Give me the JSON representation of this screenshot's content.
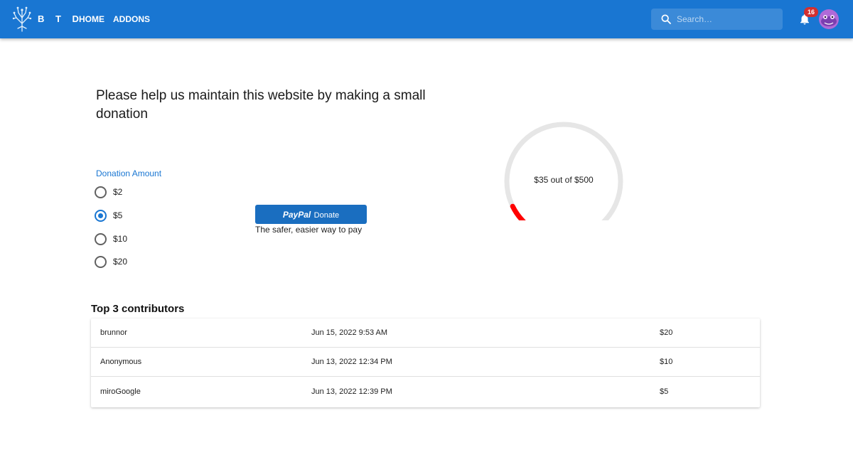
{
  "header": {
    "brand": "B T D",
    "nav": [
      "HOME",
      "ADDONS"
    ],
    "search_placeholder": "Search…",
    "notification_count": "16"
  },
  "donation": {
    "headline": "Please help us maintain this website by making a small donation",
    "amount_label": "Donation Amount",
    "options": [
      "$2",
      "$5",
      "$10",
      "$20"
    ],
    "selected": "$5",
    "paypal_brand": "PayPal",
    "paypal_label": "Donate",
    "paypal_tagline": "The safer, easier way to pay",
    "goal_text": "$35 out of $500",
    "raised": 35,
    "goal": 500
  },
  "contributors": {
    "title": "Top 3 contributors",
    "rows": [
      {
        "name": "brunnor",
        "date": "Jun 15, 2022 9:53 AM",
        "amount": "$20"
      },
      {
        "name": "Anonymous",
        "date": "Jun 13, 2022 12:34 PM",
        "amount": "$10"
      },
      {
        "name": "miroGoogle",
        "date": "Jun 13, 2022 12:39 PM",
        "amount": "$5"
      }
    ]
  },
  "colors": {
    "appbar": "#1976d2",
    "accent": "#1976d2",
    "gauge_track": "#e6e6e6",
    "gauge_fill": "#ff0000"
  }
}
